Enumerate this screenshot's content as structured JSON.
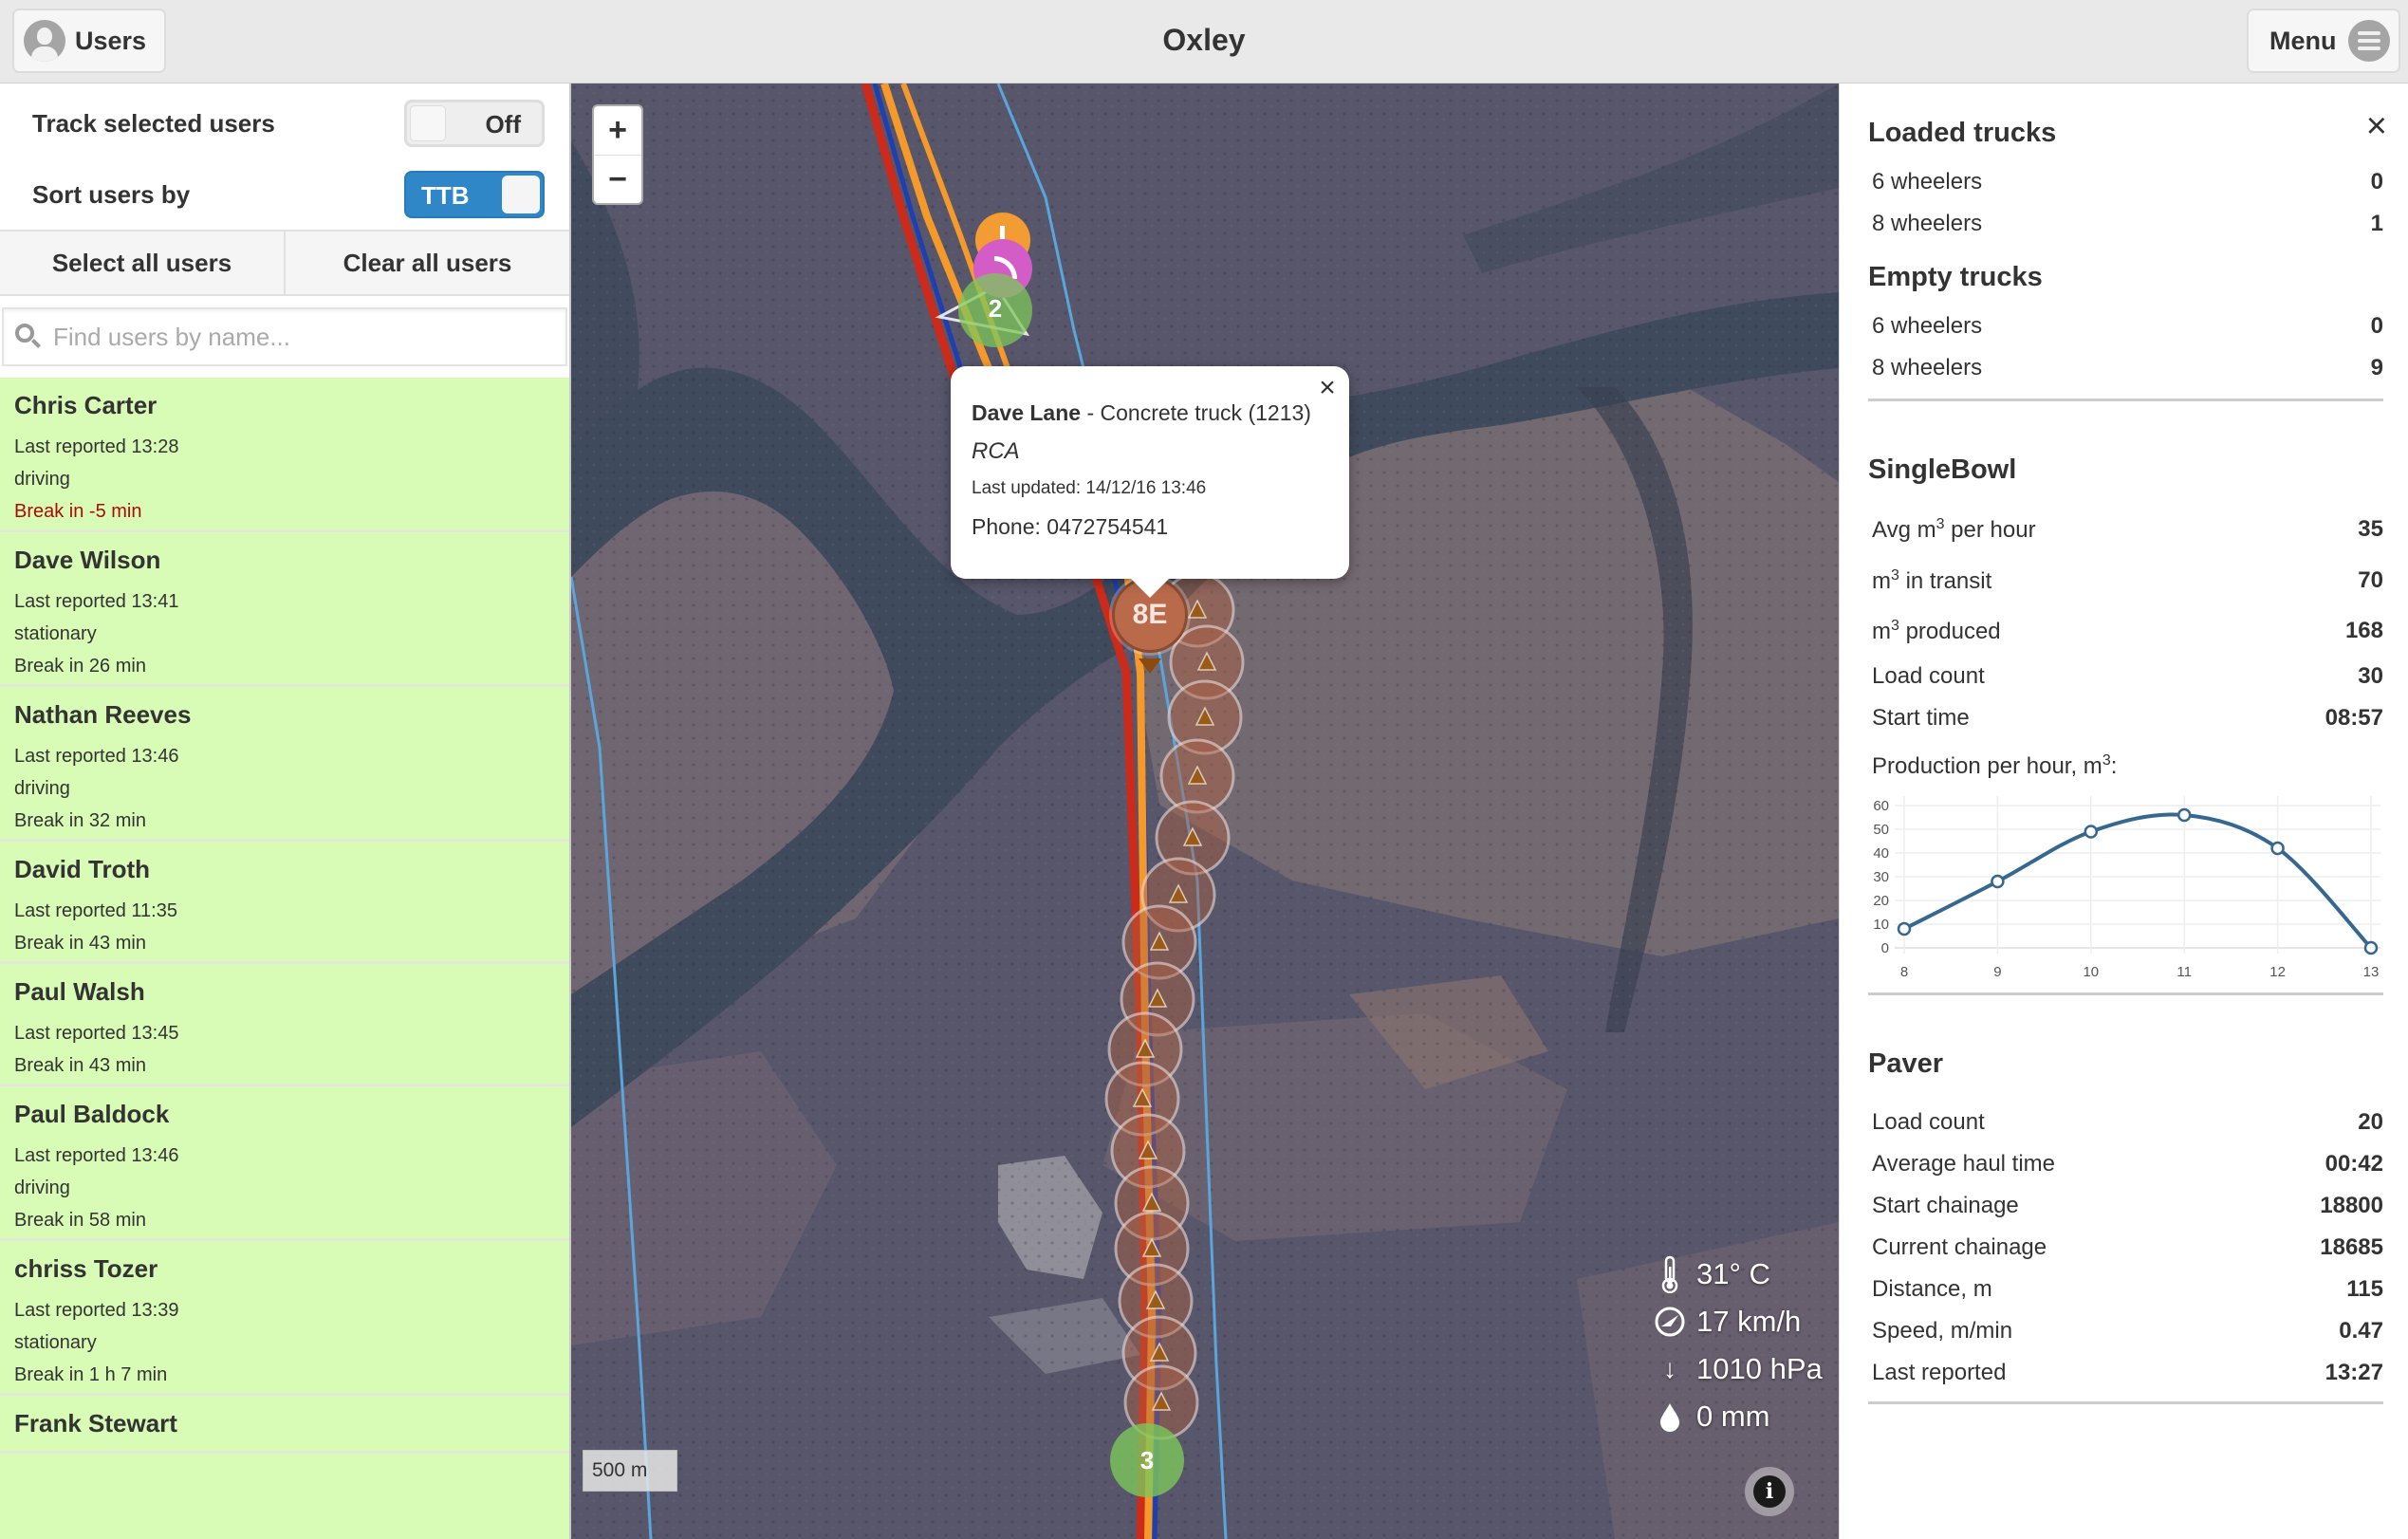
{
  "header": {
    "title": "Oxley",
    "users_button": "Users",
    "menu_button": "Menu"
  },
  "sidebar": {
    "track_label": "Track selected users",
    "track_toggle": "Off",
    "sort_label": "Sort users by",
    "sort_toggle": "TTB",
    "select_all": "Select all users",
    "clear_all": "Clear all users",
    "search_placeholder": "Find users by name...",
    "users": [
      {
        "name": "Chris Carter",
        "reported": "Last reported 13:28",
        "status": "driving",
        "break": "Break in -5 min",
        "overdue": true
      },
      {
        "name": "Dave Wilson",
        "reported": "Last reported 13:41",
        "status": "stationary",
        "break": "Break in 26 min",
        "overdue": false
      },
      {
        "name": "Nathan Reeves",
        "reported": "Last reported 13:46",
        "status": "driving",
        "break": "Break in 32 min",
        "overdue": false
      },
      {
        "name": "David Troth",
        "reported": "Last reported 11:35",
        "status": "",
        "break": "Break in 43 min",
        "overdue": false
      },
      {
        "name": "Paul Walsh",
        "reported": "Last reported 13:45",
        "status": "",
        "break": "Break in 43 min",
        "overdue": false
      },
      {
        "name": "Paul Baldock",
        "reported": "Last reported 13:46",
        "status": "driving",
        "break": "Break in 58 min",
        "overdue": false
      },
      {
        "name": "chriss Tozer",
        "reported": "Last reported 13:39",
        "status": "stationary",
        "break": "Break in 1 h 7 min",
        "overdue": false
      },
      {
        "name": "Frank Stewart",
        "reported": "",
        "status": "",
        "break": "",
        "overdue": false
      }
    ]
  },
  "map": {
    "zoom_in": "+",
    "zoom_out": "−",
    "scale": "500 m",
    "popup": {
      "driver": "Dave Lane",
      "vehicle": " - Concrete truck (1213)",
      "material": "RCA",
      "updated": "Last updated: 14/12/16 13:46",
      "phone": "Phone: 0472754541",
      "close": "×"
    },
    "markers": {
      "selected_truck": "8E",
      "cluster_top": "2",
      "cluster_bottom": "3"
    },
    "weather": {
      "temperature": "31° C",
      "wind": "17 km/h",
      "pressure": "1010 hPa",
      "rain": "0 mm"
    },
    "info": "i",
    "colors": {
      "route_orange": "#f59a2a",
      "route_red": "#cc2a1a",
      "route_blue": "#1f3fb0",
      "boundary_blue": "#5aa6dc",
      "trail_marker": "#b06040",
      "cluster_green": "#7cc75a",
      "alert_orange": "#f39c34",
      "signal_magenta": "#d35cc7"
    }
  },
  "panel": {
    "close": "×",
    "loaded": {
      "title": "Loaded trucks",
      "rows": [
        {
          "label": "6 wheelers",
          "value": "0"
        },
        {
          "label": "8 wheelers",
          "value": "1"
        }
      ]
    },
    "empty": {
      "title": "Empty trucks",
      "rows": [
        {
          "label": "6 wheelers",
          "value": "0"
        },
        {
          "label": "8 wheelers",
          "value": "9"
        }
      ]
    },
    "singlebowl": {
      "title": "SingleBowl",
      "avg_pre": "Avg m",
      "avg_post": " per hour",
      "avg_value": "35",
      "transit_pre": "m",
      "transit_post": " in transit",
      "transit_value": "70",
      "produced_pre": "m",
      "produced_post": " produced",
      "produced_value": "168",
      "load_label": "Load count",
      "load_value": "30",
      "start_label": "Start time",
      "start_value": "08:57",
      "chart_label_pre": "Production per hour, m",
      "chart_label_post": ":",
      "sup": "3"
    },
    "paver": {
      "title": "Paver",
      "rows": [
        {
          "label": "Load count",
          "value": "20"
        },
        {
          "label": "Average haul time",
          "value": "00:42"
        },
        {
          "label": "Start chainage",
          "value": "18800"
        },
        {
          "label": "Current chainage",
          "value": "18685"
        },
        {
          "label": "Distance, m",
          "value": "115"
        },
        {
          "label": "Speed, m/min",
          "value": "0.47"
        },
        {
          "label": "Last reported",
          "value": "13:27"
        }
      ]
    }
  },
  "chart_data": {
    "type": "line",
    "title": "Production per hour, m3",
    "xlabel": "",
    "ylabel": "",
    "x": [
      8,
      9,
      10,
      11,
      12,
      13
    ],
    "series": [
      {
        "name": "Production",
        "values": [
          8,
          28,
          49,
          56,
          42,
          0
        ],
        "color": "#36678f"
      }
    ],
    "xlim": [
      8,
      13
    ],
    "ylim": [
      0,
      60
    ],
    "yticks": [
      0,
      10,
      20,
      30,
      40,
      50,
      60
    ],
    "xticks": [
      "8",
      "9",
      "10",
      "11",
      "12",
      "13"
    ],
    "grid": true,
    "smooth": true
  }
}
